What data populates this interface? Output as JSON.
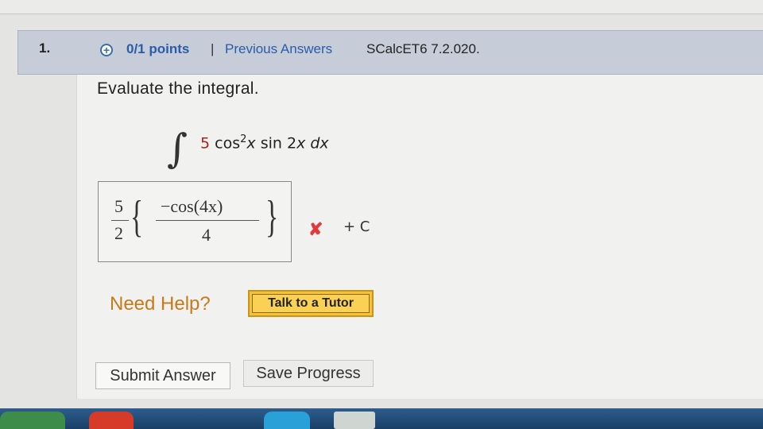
{
  "question": {
    "number": "1.",
    "points": "0/1 points",
    "separator": "|",
    "previous_answers": "Previous Answers",
    "source": "SCalcET6 7.2.020."
  },
  "prompt": "Evaluate the integral.",
  "integral": {
    "sign": "∫",
    "coefficient": "5",
    "cos": "cos",
    "cos_power": "2",
    "x1": "x",
    "sin": "sin 2",
    "x2": "x",
    "d": "d",
    "x3": "x"
  },
  "answer": {
    "frac_num": "5",
    "frac_den": "2",
    "inner_num": "−cos(4x)",
    "inner_den": "4",
    "left_brace": "{",
    "right_brace": "}",
    "status_icon": "✘",
    "constant": "+ C"
  },
  "help": {
    "label": "Need Help?",
    "tutor_button": "Talk to a Tutor"
  },
  "buttons": {
    "submit": "Submit Answer",
    "save": "Save Progress"
  },
  "colors": {
    "points_link": "#2a5caa",
    "incorrect": "#e23a3a",
    "need_help": "#c77a1c",
    "tutor_button": "#f5c23a"
  },
  "taskbar_icons": [
    "start-orb-icon",
    "chrome-icon",
    "internet-explorer-icon",
    "app-icon"
  ]
}
